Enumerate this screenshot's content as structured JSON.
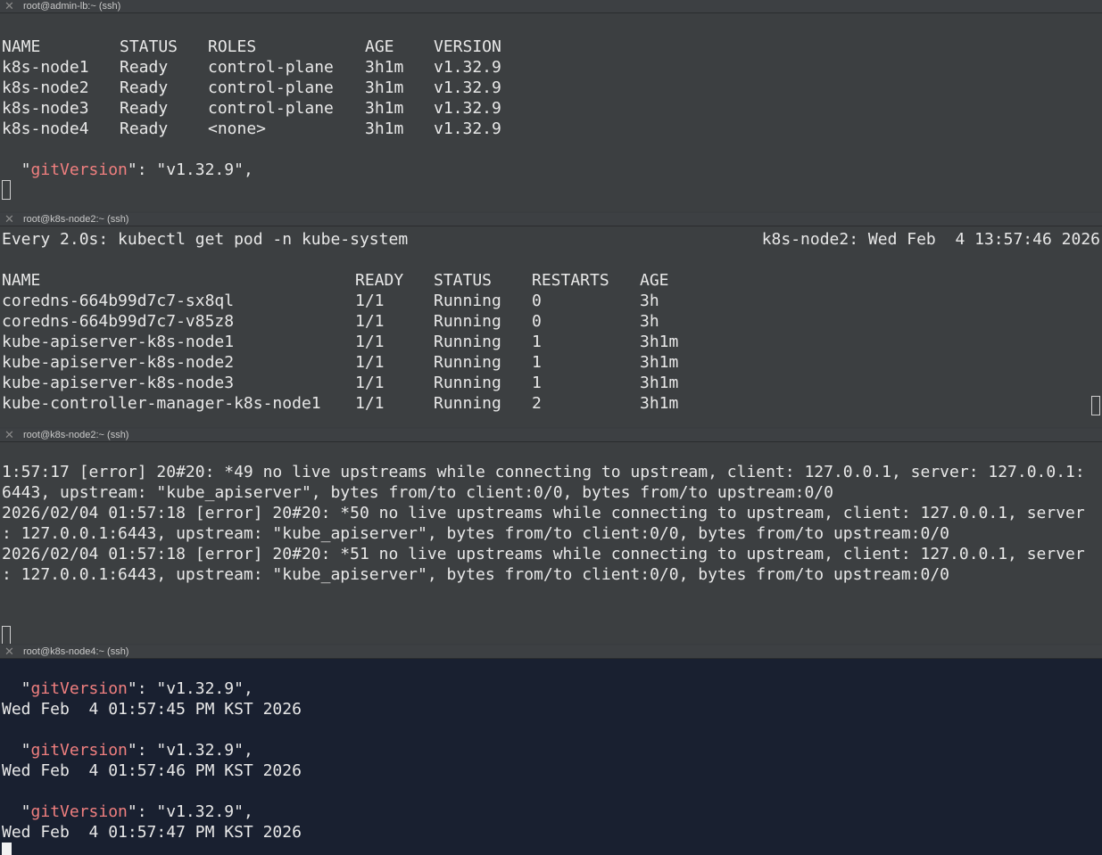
{
  "panes": [
    {
      "title": "root@admin-lb:~ (ssh)",
      "nodes": {
        "headers": [
          "NAME",
          "STATUS",
          "ROLES",
          "AGE",
          "VERSION"
        ],
        "rows": [
          [
            "k8s-node1",
            "Ready",
            "control-plane",
            "3h1m",
            "v1.32.9"
          ],
          [
            "k8s-node2",
            "Ready",
            "control-plane",
            "3h1m",
            "v1.32.9"
          ],
          [
            "k8s-node3",
            "Ready",
            "control-plane",
            "3h1m",
            "v1.32.9"
          ],
          [
            "k8s-node4",
            "Ready",
            "<none>",
            "3h1m",
            "v1.32.9"
          ]
        ]
      },
      "git_key": "gitVersion",
      "git_value": ": \"v1.32.9\","
    },
    {
      "title": "root@k8s-node2:~ (ssh)",
      "watch_cmd": "Every 2.0s: kubectl get pod -n kube-system",
      "watch_host_time": "k8s-node2: Wed Feb  4 13:57:46 2026",
      "pods": {
        "headers": [
          "NAME",
          "READY",
          "STATUS",
          "RESTARTS",
          "AGE"
        ],
        "rows": [
          [
            "coredns-664b99d7c7-sx8ql",
            "1/1",
            "Running",
            "0",
            "3h"
          ],
          [
            "coredns-664b99d7c7-v85z8",
            "1/1",
            "Running",
            "0",
            "3h"
          ],
          [
            "kube-apiserver-k8s-node1",
            "1/1",
            "Running",
            "1",
            "3h1m"
          ],
          [
            "kube-apiserver-k8s-node2",
            "1/1",
            "Running",
            "1",
            "3h1m"
          ],
          [
            "kube-apiserver-k8s-node3",
            "1/1",
            "Running",
            "1",
            "3h1m"
          ],
          [
            "kube-controller-manager-k8s-node1",
            "1/1",
            "Running",
            "2",
            "3h1m"
          ]
        ]
      }
    },
    {
      "title": "root@k8s-node2:~ (ssh)",
      "log_lines": [
        "1:57:17 [error] 20#20: *49 no live upstreams while connecting to upstream, client: 127.0.0.1, server: 127.0.0.1:",
        "6443, upstream: \"kube_apiserver\", bytes from/to client:0/0, bytes from/to upstream:0/0",
        "2026/02/04 01:57:18 [error] 20#20: *50 no live upstreams while connecting to upstream, client: 127.0.0.1, server",
        ": 127.0.0.1:6443, upstream: \"kube_apiserver\", bytes from/to client:0/0, bytes from/to upstream:0/0",
        "2026/02/04 01:57:18 [error] 20#20: *51 no live upstreams while connecting to upstream, client: 127.0.0.1, server",
        ": 127.0.0.1:6443, upstream: \"kube_apiserver\", bytes from/to client:0/0, bytes from/to upstream:0/0"
      ]
    },
    {
      "title": "root@k8s-node4:~ (ssh)",
      "entries": [
        {
          "key": "gitVersion",
          "value": ": \"v1.32.9\",",
          "date": "Wed Feb  4 01:57:45 PM KST 2026"
        },
        {
          "key": "gitVersion",
          "value": ": \"v1.32.9\",",
          "date": "Wed Feb  4 01:57:46 PM KST 2026"
        },
        {
          "key": "gitVersion",
          "value": ": \"v1.32.9\",",
          "date": "Wed Feb  4 01:57:47 PM KST 2026"
        }
      ]
    }
  ],
  "icons": {
    "close": "close-icon"
  },
  "colors": {
    "key_highlight": "#f07f7f",
    "pane_bg": "#3c3f41",
    "active_pane_bg": "#192030"
  }
}
